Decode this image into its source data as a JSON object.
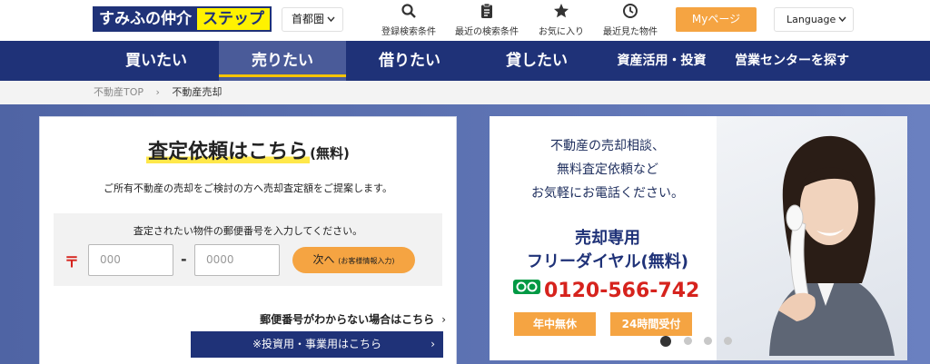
{
  "header": {
    "logo_part1": "すみふの仲介",
    "logo_part2": "ステップ",
    "region": "首都圏",
    "icons": [
      {
        "icon": "search-icon",
        "label": "登録検索条件"
      },
      {
        "icon": "clipboard-icon",
        "label": "最近の検索条件"
      },
      {
        "icon": "star-icon",
        "label": "お気に入り"
      },
      {
        "icon": "clock-icon",
        "label": "最近見た物件"
      }
    ],
    "mypage": "Myページ",
    "language": "Language"
  },
  "nav": {
    "items": [
      "買いたい",
      "売りたい",
      "借りたい",
      "貸したい",
      "資産活用・投資",
      "営業センターを探す"
    ],
    "active": "売りたい"
  },
  "breadcrumb": {
    "home": "不動産TOP",
    "separator": "›",
    "current": "不動産売却"
  },
  "form": {
    "title": "査定依頼はこちら",
    "title_suffix": "(無料)",
    "subtitle": "ご所有不動産の売却をご検討の方へ売却査定額をご提案します。",
    "zip_label": "査定されたい物件の郵便番号を入力してください。",
    "zip_mark": "〒",
    "zip1_placeholder": "000",
    "zip2_placeholder": "0000",
    "dash": "-",
    "next_label": "次へ",
    "next_sub": "(お客様情報入力)",
    "unknown_zip_link": "郵便番号がわからない場合はこちら",
    "invest_button": "※投資用・事業用はこちら"
  },
  "banner": {
    "line1": "不動産の売却相談、",
    "line2": "無料査定依頼など",
    "line3": "お気軽にお電話ください。",
    "heading1": "売却専用",
    "heading2": "フリーダイヤル(無料)",
    "phone": "0120-566-742",
    "badge1": "年中無休",
    "badge2": "24時間受付"
  },
  "carousel": {
    "count": 4,
    "active_index": 0
  },
  "colors": {
    "navy": "#1f3278",
    "orange": "#f5a442",
    "yellow": "#ffe84a",
    "red": "#d6231d"
  }
}
